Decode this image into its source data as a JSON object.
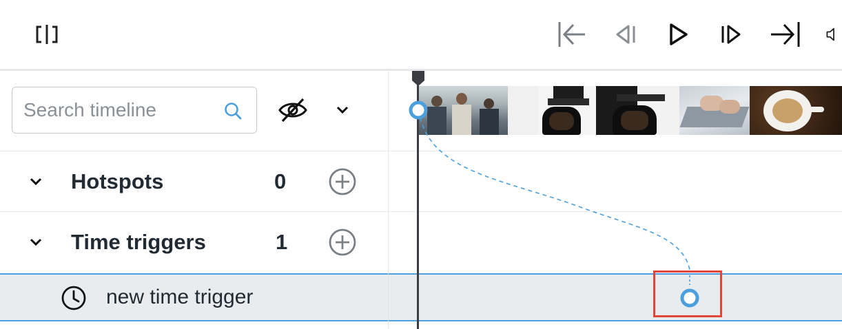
{
  "toolbar": {
    "split_icon": "split-view-icon",
    "skip_to_start_icon": "skip-to-start-icon",
    "step_back_icon": "step-back-icon",
    "play_icon": "play-icon",
    "step_forward_icon": "step-forward-icon",
    "skip_to_end_icon": "skip-to-end-icon",
    "volume_icon": "volume-icon"
  },
  "search": {
    "placeholder": "Search timeline",
    "value": "",
    "icon": "search-icon"
  },
  "visibility": {
    "icon": "eye-off-icon",
    "dropdown_icon": "chevron-down-icon"
  },
  "groups": [
    {
      "label": "Hotspots",
      "count": "0",
      "expand_icon": "chevron-down-icon",
      "add_icon": "plus-circle-icon"
    },
    {
      "label": "Time triggers",
      "count": "1",
      "expand_icon": "chevron-down-icon",
      "add_icon": "plus-circle-icon"
    }
  ],
  "items": [
    {
      "label": "new time trigger",
      "icon": "clock-icon",
      "selected": true
    }
  ],
  "colors": {
    "accent": "#4a9fdc",
    "highlight": "#e2463a",
    "selected_bg": "#e9ecef",
    "playhead": "#3a3d42",
    "text": "#222b33"
  }
}
